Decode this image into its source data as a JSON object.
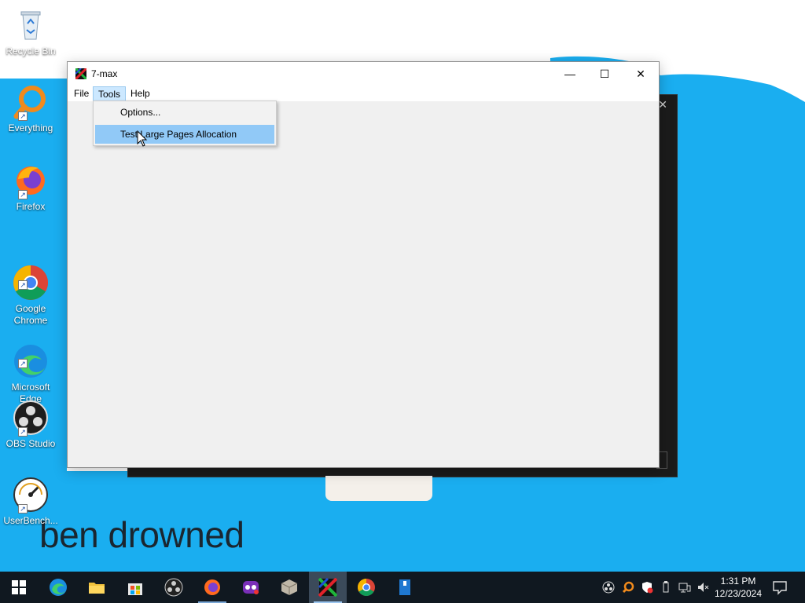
{
  "desktop": {
    "wallpaper_text": "ben drowned",
    "icons": [
      {
        "label": "Recycle Bin",
        "icon": "recycle-bin-icon"
      },
      {
        "label": "Everything",
        "icon": "everything-search-icon"
      },
      {
        "label": "Firefox",
        "icon": "firefox-icon"
      },
      {
        "label": "Google\nChrome",
        "icon": "chrome-icon"
      },
      {
        "label": "Microsoft\nEdge",
        "icon": "edge-icon"
      },
      {
        "label": "OBS Studio",
        "icon": "obs-icon"
      },
      {
        "label": "UserBench...",
        "icon": "userbenchmark-icon"
      }
    ]
  },
  "window": {
    "title": "7-max",
    "controls": {
      "minimize": "—",
      "maximize": "☐",
      "close": "✕"
    },
    "menu": [
      "File",
      "Tools",
      "Help"
    ],
    "open_menu": "Tools",
    "dropdown": [
      "Options...",
      "Test Large Pages Allocation"
    ],
    "highlighted_item": "Test Large Pages Allocation"
  },
  "taskbar": {
    "items": [
      "start-icon",
      "edge-icon",
      "file-explorer-icon",
      "microsoft-store-icon",
      "obs-icon",
      "firefox-icon",
      "app-icon",
      "package-icon",
      "7-max-icon",
      "chrome-icon",
      "archive-icon"
    ],
    "active": "7-max-icon",
    "clock": {
      "time": "1:31 PM",
      "date": "12/23/2024"
    }
  },
  "colors": {
    "wallpaper_blue": "#1aaef0",
    "taskbar": "#101820",
    "menu_highlight": "#91c9f7",
    "tools_highlight": "#cce8ff"
  }
}
